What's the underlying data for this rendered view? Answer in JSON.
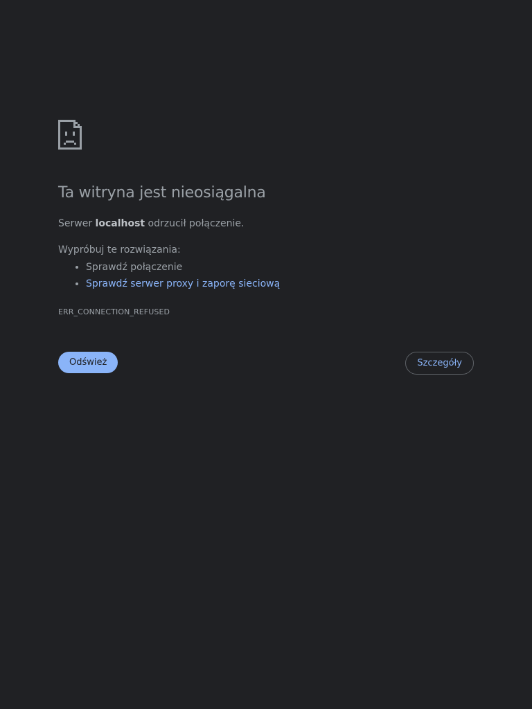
{
  "error": {
    "title": "Ta witryna jest nieosiągalna",
    "summary_prefix": "Serwer ",
    "host": "localhost",
    "summary_suffix": " odrzucił połączenie.",
    "try_label": "Wypróbuj te rozwiązania:",
    "suggestions": [
      {
        "label": "Sprawdź połączenie"
      },
      {
        "label": "Sprawdź serwer proxy i zaporę sieciową"
      }
    ],
    "code": "ERR_CONNECTION_REFUSED"
  },
  "buttons": {
    "reload_label": "Odśwież",
    "details_label": "Szczegóły"
  },
  "icon": "sad-page-icon",
  "colors": {
    "background": "#202124",
    "text": "#9aa0a6",
    "link": "#8ab4f8",
    "primary_button": "#8ab4f8"
  }
}
